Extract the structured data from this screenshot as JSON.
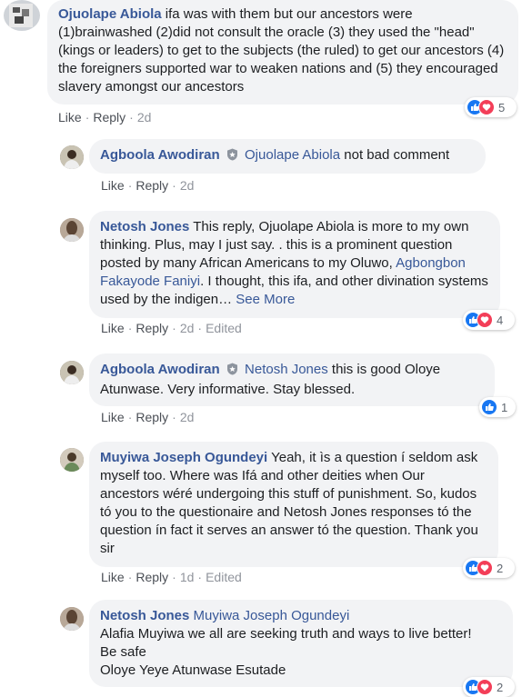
{
  "colors": {
    "link": "#385898",
    "bubble": "#f2f3f5",
    "like": "#1877f2",
    "love": "#f33e58"
  },
  "actions": {
    "like": "Like",
    "reply": "Reply",
    "edited": "Edited",
    "see_more": "See More"
  },
  "comments": [
    {
      "author": "Ojuolape Abiola",
      "text": "ifa was with them but our ancestors were (1)brainwashed (2)did not consult the oracle (3) they used the \"head\"(kings or leaders) to get to the subjects (the ruled) to get our ancestors (4) the foreigners supported war to weaken nations and (5) they encouraged slavery amongst our ancestors",
      "time": "2d",
      "reactions": "5"
    },
    {
      "author": "Agboola Awodiran",
      "mention": "Ojuolape Abiola",
      "text": "not bad comment",
      "time": "2d"
    },
    {
      "author": "Netosh Jones",
      "text_a": "This reply, Ojuolape Abiola is more to my own thinking. Plus, may I just say. . this is a prominent question posted by many African Americans to my Oluwo,",
      "mention": "Agbongbon Fakayode Faniyi",
      "text_b": ". I thought, this ifa, and other divination systems used by the indigen…",
      "time": "2d",
      "reactions": "4"
    },
    {
      "author": "Agboola Awodiran",
      "mention": "Netosh Jones",
      "text": "this is good Oloye Atunwase. Very informative. Stay blessed.",
      "time": "2d",
      "reactions": "1"
    },
    {
      "author": "Muyiwa Joseph Ogundeyi",
      "text": "Yeah, it ìs a question í seldom ask myself too. Where was Ifá and other deities when Our ancestors wéré undergoing this stuff of punishment. So, kudos tó you to the questionaire and Netosh Jones responses tó the question ín fact it serves an answer tó the question. Thank you sir",
      "time": "1d",
      "reactions": "2"
    },
    {
      "author": "Netosh Jones",
      "mention": "Muyiwa Joseph Ogundeyi",
      "line1": "Alafia Muyiwa we all are seeking truth and ways to live better!",
      "line2": "Be safe",
      "line3": "Oloye Yeye Atunwase Esutade",
      "reactions": "2"
    }
  ]
}
